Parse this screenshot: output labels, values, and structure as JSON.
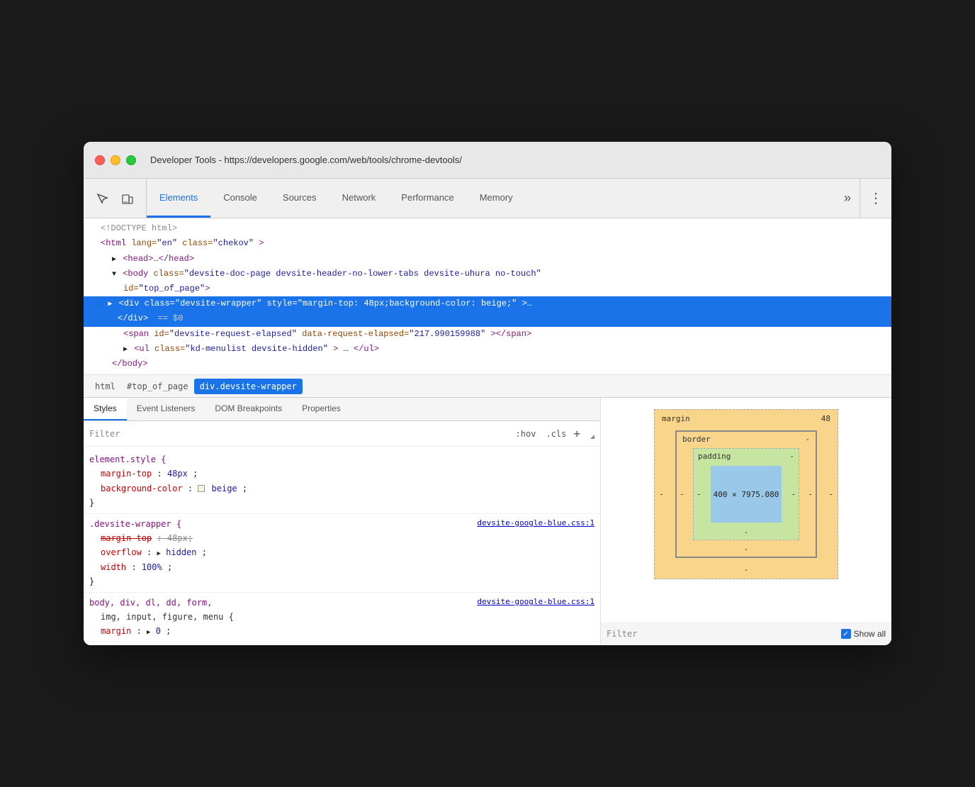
{
  "window": {
    "title": "Developer Tools - https://developers.google.com/web/tools/chrome-devtools/"
  },
  "tabs": [
    {
      "label": "Elements",
      "active": true
    },
    {
      "label": "Console",
      "active": false
    },
    {
      "label": "Sources",
      "active": false
    },
    {
      "label": "Network",
      "active": false
    },
    {
      "label": "Performance",
      "active": false
    },
    {
      "label": "Memory",
      "active": false
    }
  ],
  "dom_lines": [
    {
      "text": "<!DOCTYPE html>",
      "indent": 1,
      "type": "comment"
    },
    {
      "text": "<html lang=\"en\" class=\"chekov\">",
      "indent": 1,
      "type": "tag"
    },
    {
      "text": "▶<head>…</head>",
      "indent": 2,
      "type": "collapsed"
    },
    {
      "text": "▼<body class=\"devsite-doc-page devsite-header-no-lower-tabs devsite-uhura no-touch\"",
      "indent": 2,
      "type": "expanded"
    },
    {
      "text": "id=\"top_of_page\">",
      "indent": 3,
      "type": "attr"
    },
    {
      "text": "▶<div class=\"devsite-wrapper\" style=\"margin-top: 48px;background-color: beige;\">…",
      "indent": 3,
      "type": "selected",
      "has_dots": true
    },
    {
      "text": "</div> == $0",
      "indent": 4,
      "type": "selected_end"
    },
    {
      "text": "<span id=\"devsite-request-elapsed\" data-request-elapsed=\"217.990159988\"></span>",
      "indent": 3,
      "type": "normal"
    },
    {
      "text": "▶<ul class=\"kd-menulist devsite-hidden\">…</ul>",
      "indent": 3,
      "type": "normal"
    },
    {
      "text": "</body>",
      "indent": 2,
      "type": "normal"
    }
  ],
  "breadcrumb": [
    {
      "label": "html",
      "active": false
    },
    {
      "label": "#top_of_page",
      "active": false
    },
    {
      "label": "div.devsite-wrapper",
      "active": true
    }
  ],
  "panel_tabs": [
    {
      "label": "Styles",
      "active": true
    },
    {
      "label": "Event Listeners",
      "active": false
    },
    {
      "label": "DOM Breakpoints",
      "active": false
    },
    {
      "label": "Properties",
      "active": false
    }
  ],
  "filter": {
    "placeholder": "Filter",
    "hov_label": ":hov",
    "cls_label": ".cls",
    "plus_label": "+"
  },
  "css_rules": [
    {
      "selector": "element.style {",
      "source": null,
      "props": [
        {
          "name": "margin-top",
          "value": "48px",
          "strikethrough": false,
          "has_color": false
        },
        {
          "name": "background-color",
          "value": "beige",
          "strikethrough": false,
          "has_color": true
        }
      ]
    },
    {
      "selector": ".devsite-wrapper {",
      "source": "devsite-google-blue.css:1",
      "props": [
        {
          "name": "margin-top",
          "value": "48px",
          "strikethrough": true,
          "has_color": false
        },
        {
          "name": "overflow",
          "value": "hidden",
          "strikethrough": false,
          "has_color": false,
          "has_triangle": true
        },
        {
          "name": "width",
          "value": "100%",
          "strikethrough": false,
          "has_color": false
        }
      ]
    },
    {
      "selector": "body, div, dl, dd, form,",
      "source": "devsite-google-blue.css:1",
      "props": [
        {
          "name": "img, input, figure, menu {",
          "value": "",
          "strikethrough": false,
          "has_color": false
        },
        {
          "name": "margin",
          "value": "▶ 0",
          "strikethrough": false,
          "has_color": false,
          "has_triangle": true
        }
      ]
    }
  ],
  "box_model": {
    "margin_label": "margin",
    "margin_value": "48",
    "border_label": "border",
    "border_value": "-",
    "padding_label": "padding",
    "padding_value": "-",
    "content_value": "400 × 7975.080",
    "side_values": [
      "-",
      "-",
      "-",
      "-"
    ]
  },
  "filter_bottom": {
    "label": "Filter",
    "show_all": "Show all"
  }
}
